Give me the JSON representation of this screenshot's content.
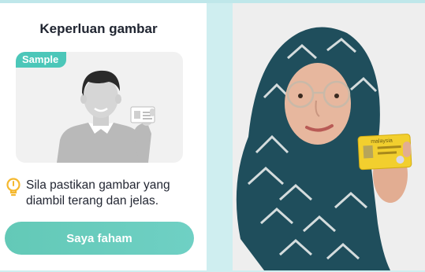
{
  "card": {
    "title": "Keperluan gambar",
    "sample_badge": "Sample",
    "tip_text": "Sila pastikan gambar yang diambil terang dan jelas.",
    "button_label": "Saya faham"
  },
  "photo": {
    "card_text": "malaysia"
  },
  "icons": {
    "tip": "lightbulb-icon"
  },
  "colors": {
    "accent": "#4cc7b9",
    "button": "#68cdbd",
    "background": "#cfeef0"
  }
}
